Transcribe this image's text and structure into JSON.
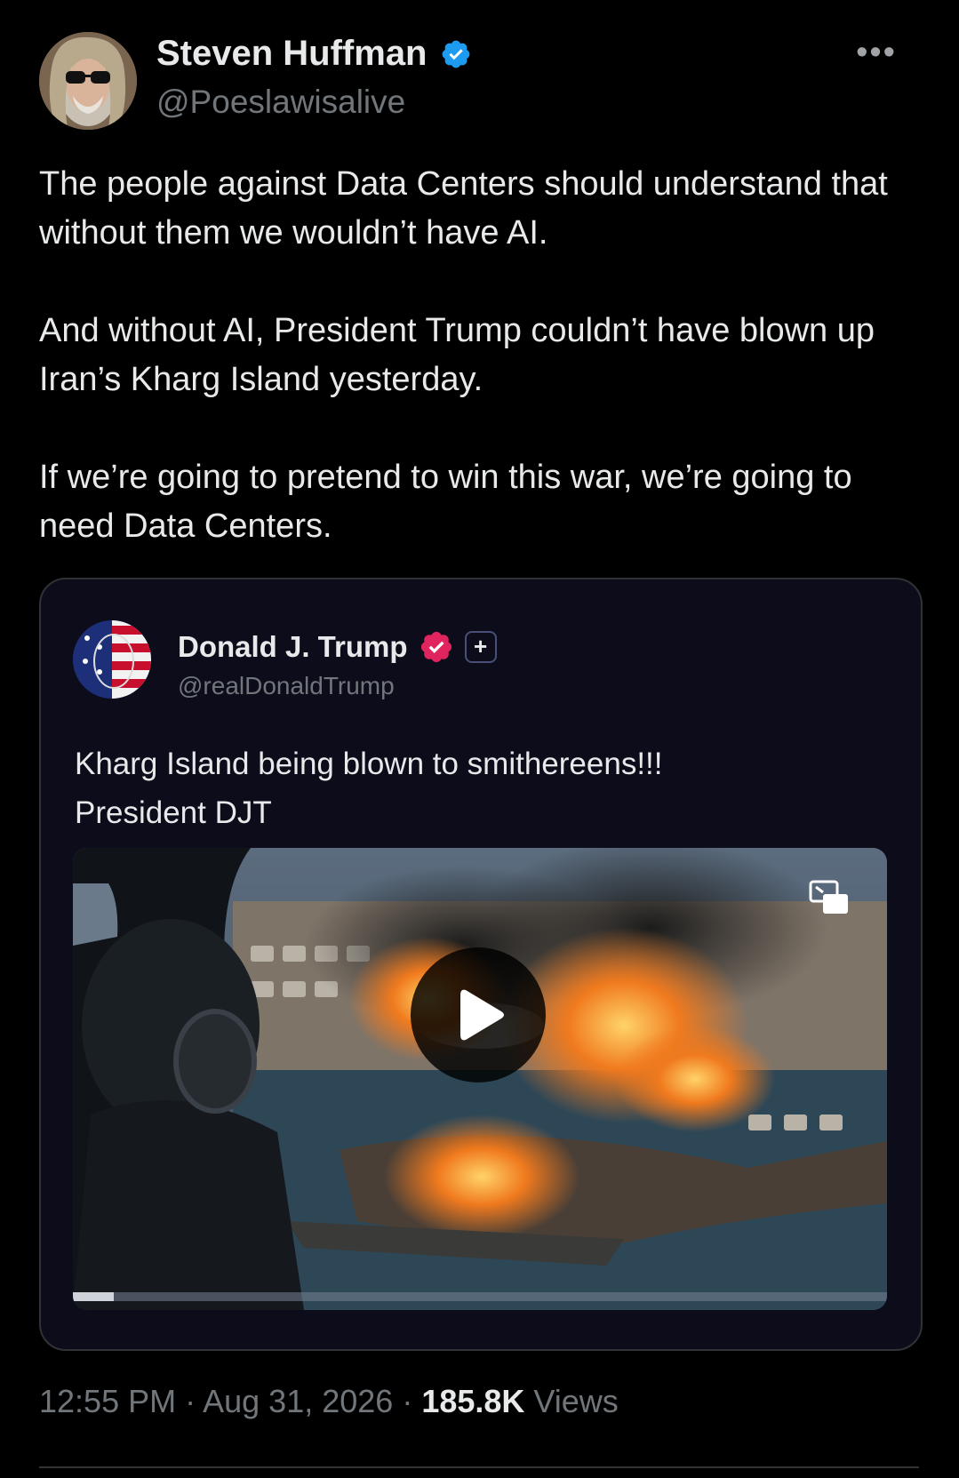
{
  "author": {
    "name": "Steven Huffman",
    "handle": "@Poeslawisalive",
    "verified_color": "#1d9bf0"
  },
  "more_icon": "more-horizontal-icon",
  "tweet": {
    "paragraphs": [
      "The people against Data Centers should understand that without them we wouldn’t have AI.",
      "And without AI, President Trump couldn’t have blown up Iran’s Kharg Island yesterday.",
      "If we’re going to pretend to win this war, we’re going to need Data Centers."
    ]
  },
  "quote": {
    "name": "Donald J. Trump",
    "handle": "@realDonaldTrump",
    "verified_color": "#e0245e",
    "plus_label": "+",
    "text_lines": [
      "Kharg Island being blown to smithereens!!!",
      "President DJT"
    ],
    "video": {
      "play_icon": "play-icon",
      "pip_icon": "picture-in-picture-icon",
      "progress": 0.05
    }
  },
  "meta": {
    "time": "12:55 PM",
    "sep1": " · ",
    "date": "Aug 31, 2026",
    "sep2": " · ",
    "views_count": "185.8K",
    "views_label": " Views"
  }
}
